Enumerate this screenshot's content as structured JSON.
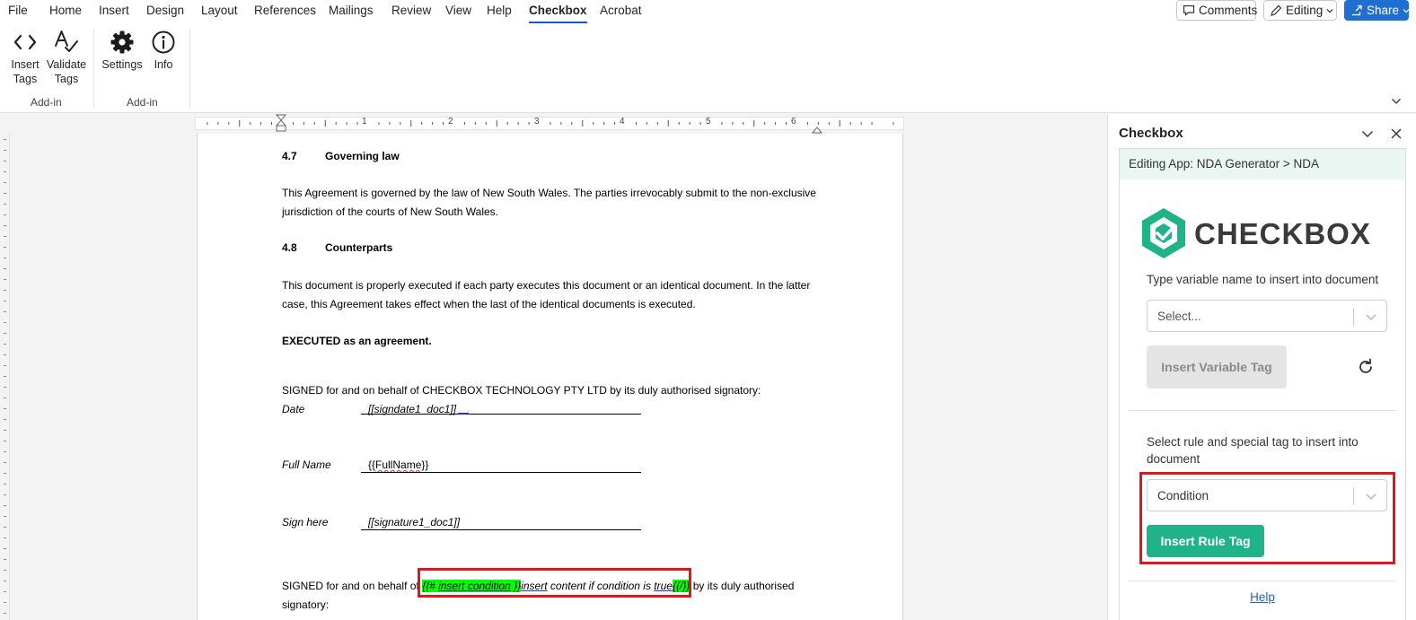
{
  "menu": {
    "tabs": [
      "File",
      "Home",
      "Insert",
      "Design",
      "Layout",
      "References",
      "Mailings",
      "Review",
      "View",
      "Help",
      "Checkbox",
      "Acrobat"
    ],
    "active_tab": "Checkbox",
    "comments_label": "Comments",
    "editing_label": "Editing",
    "share_label": "Share"
  },
  "ribbon": {
    "buttons": [
      {
        "label_line1": "Insert",
        "label_line2": "Tags",
        "icon": "code-brackets-icon"
      },
      {
        "label_line1": "Validate",
        "label_line2": "Tags",
        "icon": "spellcheck-icon"
      },
      {
        "label_line1": "Settings",
        "icon": "gear-icon"
      },
      {
        "label_line1": "Info",
        "icon": "info-icon"
      }
    ],
    "groups": [
      "Add-in",
      "Add-in"
    ]
  },
  "ruler": {
    "numbers": [
      "1",
      "2",
      "3",
      "4",
      "5",
      "6"
    ]
  },
  "document": {
    "h47_num": "4.7",
    "h47_title": "Governing law",
    "p47_line1": "This Agreement is governed by the law of New South Wales. The parties irrevocably submit to the non-exclusive",
    "p47_line2": "jurisdiction of the courts of New South Wales.",
    "h48_num": "4.8",
    "h48_title": "Counterparts",
    "p48_line1": "This document is properly executed if each party executes this document or an identical document. In the latter",
    "p48_line2": "case, this Agreement takes effect when the last of the identical documents is executed.",
    "executed": "EXECUTED as an agreement.",
    "signed1": "SIGNED for and on behalf of CHECKBOX TECHNOLOGY PTY LTD by its duly authorised signatory:",
    "date_label": "Date",
    "date_tag": "[[signdate1_doc1]]",
    "fullname_label": "Full Name",
    "fullname_tag_open": "{{",
    "fullname_tag_word": "FullName",
    "fullname_tag_close": "}}",
    "signhere_label": "Sign here",
    "signhere_tag": "[[signature1_doc1]]",
    "signed2_prefix": "SIGNED for and on behalf of",
    "cond_open": "{{# insert condition }}",
    "cond_open_hl1": "{{# ",
    "cond_open_u": "insert condition",
    "cond_open_hl2": " }}",
    "cond_body": "insert",
    "cond_body_rest": " content if condition is ",
    "cond_true": "true",
    "cond_close": "{{/}}",
    "signed2_suffix": " by its duly authorised",
    "signed2_line2": "signatory:"
  },
  "pane": {
    "title": "Checkbox",
    "breadcrumb": "Editing App: NDA Generator > NDA",
    "logo_text": "CHECKBOX",
    "brand_color": "#20b389",
    "variable_label": "Type variable name to insert into document",
    "variable_placeholder": "Select...",
    "insert_variable_button": "Insert Variable Tag",
    "rule_label": "Select rule and special tag to insert into document",
    "rule_value": "Condition",
    "insert_rule_button": "Insert Rule Tag",
    "help_link": "Help"
  }
}
